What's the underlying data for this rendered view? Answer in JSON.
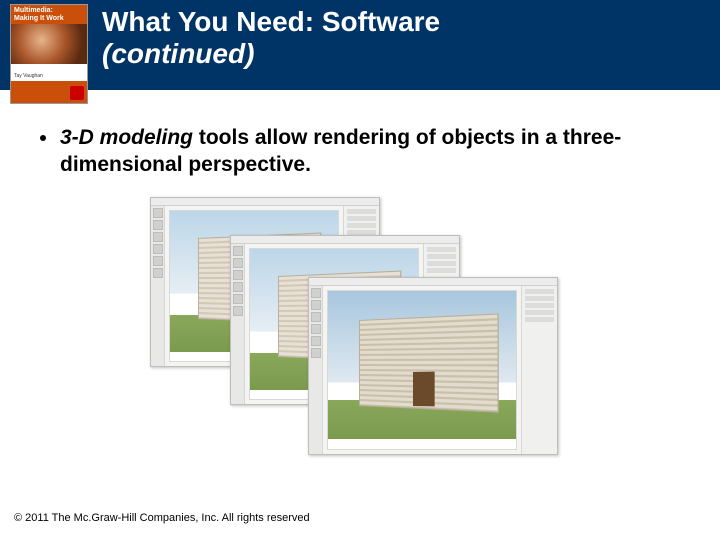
{
  "header": {
    "title": "What You Need: Software",
    "subtitle": "(continued)",
    "book_cover": {
      "series": "Multimedia:",
      "subtitle": "Making It Work",
      "author": "Tay Vaughan"
    }
  },
  "bullet": {
    "emphasis": "3-D modeling",
    "rest": " tools allow rendering of objects in a three-dimensional perspective."
  },
  "figure": {
    "description": "Three cascaded 3-D modeling application windows showing a building scene",
    "window_count": 3
  },
  "footer": {
    "copyright": "© 2011 The Mc.Graw-Hill Companies, Inc. All rights reserved"
  }
}
